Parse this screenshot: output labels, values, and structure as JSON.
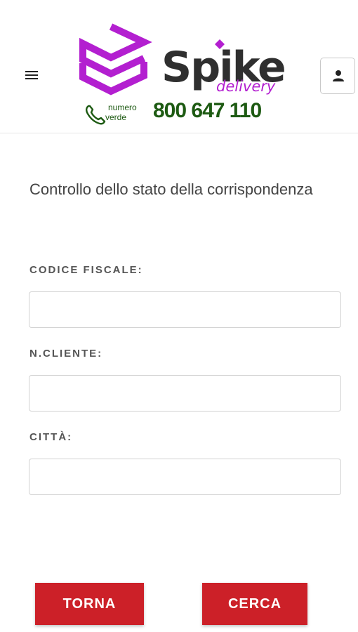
{
  "header": {
    "brand": {
      "name": "Spike",
      "tagline": "delivery",
      "phone_label_top": "numero",
      "phone_label_bottom": "verde",
      "phone_number": "800 647 110"
    },
    "menu_icon": "hamburger-icon",
    "user_icon": "user-icon"
  },
  "page": {
    "title": "Controllo dello stato della corrispondenza"
  },
  "form": {
    "codice_fiscale": {
      "label": "CODICE FISCALE:",
      "value": "",
      "placeholder": ""
    },
    "n_cliente": {
      "label": "N.CLIENTE:",
      "value": "",
      "placeholder": ""
    },
    "citta": {
      "label": "CITTÀ:",
      "value": "",
      "placeholder": ""
    }
  },
  "buttons": {
    "back": "TORNA",
    "search": "CERCA"
  },
  "colors": {
    "brand_purple": "#b31fd0",
    "brand_dark": "#2f2f2f",
    "phone_green": "#1d5a12",
    "button_red": "#cc2028"
  }
}
